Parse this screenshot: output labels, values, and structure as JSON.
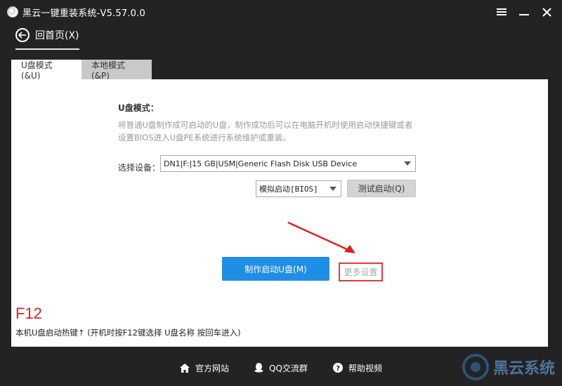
{
  "window": {
    "title": "黑云一键重装系统-V5.57.0.0"
  },
  "nav": {
    "back_label": "回首页(X)"
  },
  "tabs": [
    {
      "label": "U盘模式(&U)",
      "active": true
    },
    {
      "label": "本地模式(&P)",
      "active": false
    }
  ],
  "usb_mode": {
    "title": "U盘模式：",
    "description": "将普通U盘制作成可启动的U盘，制作成功后可以在电脑开机时使用启动快捷键或者设置BIOS进入U盘PE系统进行系统维护或重装。",
    "device_label": "选择设备：",
    "device_value": "DN1|F:|15 GB|USM|Generic Flash Disk USB Device",
    "boot_mode_value": "模拟启动[BIOS]",
    "test_boot_label": "测试启动(Q)",
    "make_button_label": "制作启动U盘(M)",
    "more_settings_label": "更多设置"
  },
  "hotkey": {
    "key": "F12",
    "hint": "本机U盘启动热键↑ (开机时按F12键选择 U盘名称 按回车进入)"
  },
  "footer": {
    "links": [
      {
        "label": "官方网站",
        "icon": "home-icon"
      },
      {
        "label": "QQ交流群",
        "icon": "qq-icon"
      },
      {
        "label": "帮助视频",
        "icon": "help-icon"
      }
    ]
  },
  "watermark": {
    "text": "黑云系统"
  },
  "colors": {
    "background": "#232323",
    "primary_button": "#1f8ee6",
    "highlight_red": "#e23a3a",
    "hotkey_red": "#e02020"
  }
}
